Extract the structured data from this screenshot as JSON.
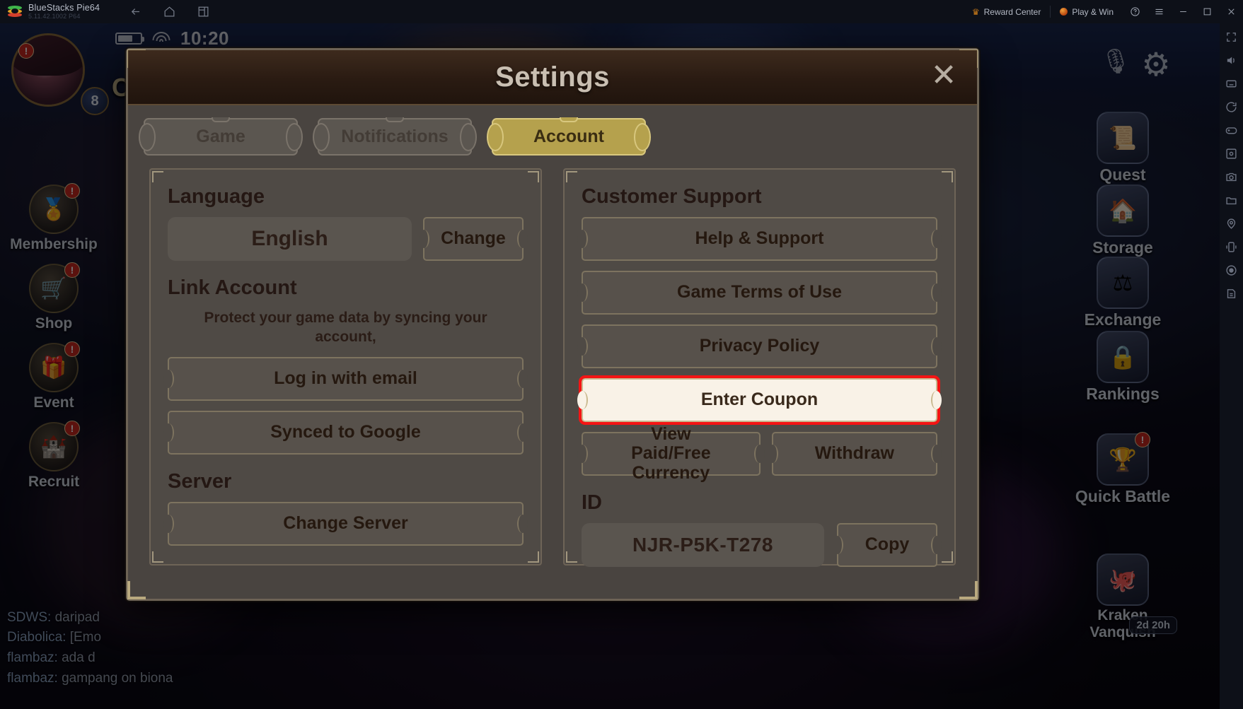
{
  "titlebar": {
    "app_name": "BlueStacks Pie64",
    "app_version": "5.11.42.1002 P64",
    "nav": [
      {
        "name": "back-icon",
        "label": "Back"
      },
      {
        "name": "home-icon",
        "label": "Home"
      },
      {
        "name": "multi-instance-icon",
        "label": "Multi-instance"
      }
    ],
    "reward_center": "Reward Center",
    "play_and_win": "Play & Win",
    "help_label": "?",
    "menu_label": "☰",
    "minimize_label": "─",
    "maximize_label": "❐",
    "close_label": "✕"
  },
  "game_background": {
    "status": {
      "time": "10:20"
    },
    "player": {
      "level": "8",
      "name_fragment": "Cr"
    },
    "left_menu": [
      {
        "label": "Membership",
        "icon": "medal-icon",
        "glyph": "★",
        "badge": "!"
      },
      {
        "label": "Shop",
        "icon": "shop-icon",
        "glyph": "🛒",
        "badge": "!"
      },
      {
        "label": "Event",
        "icon": "event-icon",
        "glyph": "🎁",
        "badge": "!"
      },
      {
        "label": "Recruit",
        "icon": "recruit-icon",
        "glyph": "🏰",
        "badge": "!"
      }
    ],
    "right_menu": [
      {
        "label": "Quest",
        "icon": "quest-icon",
        "glyph": "📜"
      },
      {
        "label": "Storage",
        "icon": "storage-icon",
        "glyph": "🏠"
      },
      {
        "label": "Exchange",
        "icon": "exchange-icon",
        "glyph": "⚖"
      },
      {
        "label": "Rankings",
        "icon": "rankings-icon",
        "glyph": "🔒"
      },
      {
        "label": "Quick Battle",
        "icon": "quick-battle-icon",
        "glyph": "🏆",
        "badge": "!"
      },
      {
        "label": "Kraken Vanquish",
        "icon": "kraken-icon",
        "glyph": "🐙"
      }
    ],
    "timer_chip": "2d 20h",
    "chat_lines": [
      {
        "name": "SDWS:",
        "text": "daripad"
      },
      {
        "name": "Diabolica:",
        "text": "[Emo"
      },
      {
        "name": "flambaz:",
        "text": "ada d"
      },
      {
        "name": "flambaz:",
        "text": "gampang on biona"
      }
    ]
  },
  "sidebar_tools": [
    {
      "name": "fullscreen-icon"
    },
    {
      "name": "volume-icon"
    },
    {
      "name": "keymapping-icon"
    },
    {
      "name": "rotate-icon"
    },
    {
      "name": "gamepad-icon"
    },
    {
      "name": "screenshot-icon"
    },
    {
      "name": "camera-icon"
    },
    {
      "name": "media-manager-icon"
    },
    {
      "name": "location-icon"
    },
    {
      "name": "shake-icon"
    },
    {
      "name": "record-icon"
    },
    {
      "name": "macro-icon"
    }
  ],
  "settings_dialog": {
    "title": "Settings",
    "close_label": "✕",
    "tabs": [
      {
        "label": "Game",
        "active": false
      },
      {
        "label": "Notifications",
        "active": false
      },
      {
        "label": "Account",
        "active": true
      }
    ],
    "left_panel": {
      "language": {
        "heading": "Language",
        "value": "English",
        "change_button": "Change"
      },
      "link_account": {
        "heading": "Link Account",
        "description": "Protect your game data by syncing your account,",
        "buttons": [
          "Log in with email",
          "Synced to Google"
        ]
      },
      "server": {
        "heading": "Server",
        "change_server_button": "Change Server"
      }
    },
    "right_panel": {
      "customer_support": {
        "heading": "Customer Support",
        "buttons": [
          {
            "label": "Help & Support",
            "highlighted": false
          },
          {
            "label": "Game Terms of Use",
            "highlighted": false
          },
          {
            "label": "Privacy Policy",
            "highlighted": false
          },
          {
            "label": "Enter Coupon",
            "highlighted": true
          }
        ],
        "split_buttons": [
          {
            "label": "View Paid/Free Currency"
          },
          {
            "label": "Withdraw"
          }
        ]
      },
      "id": {
        "heading": "ID",
        "value": "NJR-P5K-T278",
        "copy_button": "Copy"
      }
    }
  },
  "colors": {
    "highlight_red": "#f51414",
    "active_tab_gold": "#b5a14d",
    "panel_bg": "#4f4a45",
    "modal_bg": "#494440",
    "header_brown": "#2a1b12"
  }
}
